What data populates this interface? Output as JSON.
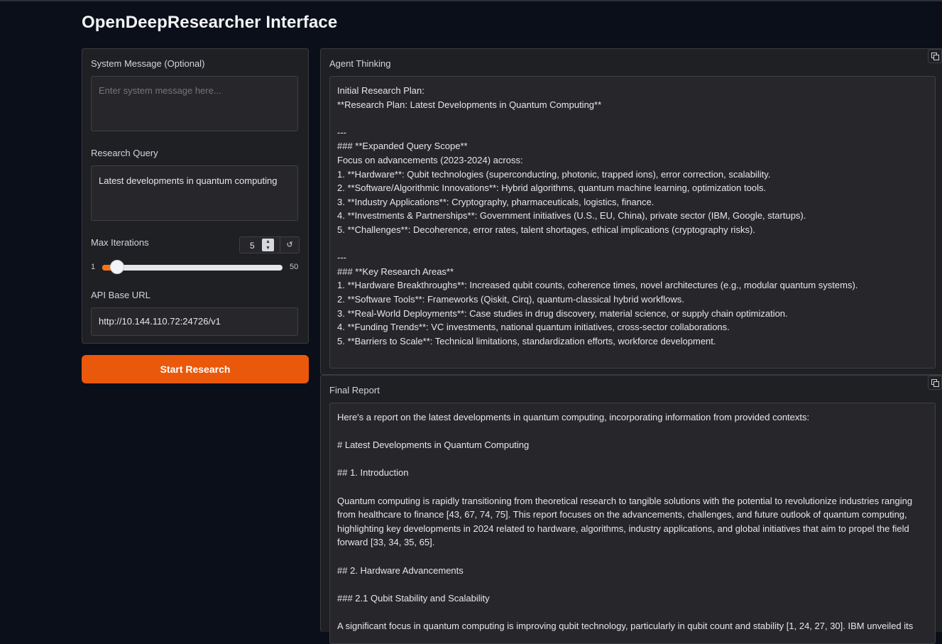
{
  "app": {
    "title": "OpenDeepResearcher Interface"
  },
  "left_panel": {
    "system_message": {
      "label": "System Message (Optional)",
      "value": "",
      "placeholder": "Enter system message here..."
    },
    "research_query": {
      "label": "Research Query",
      "value": "Latest developments in quantum computing"
    },
    "max_iterations": {
      "label": "Max Iterations",
      "value": "5",
      "min": "1",
      "max": "50",
      "reset_icon": "↺"
    },
    "api_base_url": {
      "label": "API Base URL",
      "value": "http://10.144.110.72:24726/v1"
    },
    "start_button": "Start Research"
  },
  "agent_thinking": {
    "label": "Agent Thinking",
    "lines": [
      "Initial Research Plan:",
      "**Research Plan: Latest Developments in Quantum Computing**",
      "",
      "---",
      "### **Expanded Query Scope**",
      "Focus on advancements (2023-2024) across:",
      "1. **Hardware**: Qubit technologies (superconducting, photonic, trapped ions), error correction, scalability.",
      "2. **Software/Algorithmic Innovations**: Hybrid algorithms, quantum machine learning, optimization tools.",
      "3. **Industry Applications**: Cryptography, pharmaceuticals, logistics, finance.",
      "4. **Investments & Partnerships**: Government initiatives (U.S., EU, China), private sector (IBM, Google, startups).",
      "5. **Challenges**: Decoherence, error rates, talent shortages, ethical implications (cryptography risks).",
      "",
      "---",
      "### **Key Research Areas**",
      "1. **Hardware Breakthroughs**: Increased qubit counts, coherence times, novel architectures (e.g., modular quantum systems).",
      "2. **Software Tools**: Frameworks (Qiskit, Cirq), quantum-classical hybrid workflows.",
      "3. **Real-World Deployments**: Case studies in drug discovery, material science, or supply chain optimization.",
      "4. **Funding Trends**: VC investments, national quantum initiatives, cross-sector collaborations.",
      "5. **Barriers to Scale**: Technical limitations, standardization efforts, workforce development."
    ]
  },
  "final_report": {
    "label": "Final Report",
    "paragraphs": [
      "Here's a report on the latest developments in quantum computing, incorporating information from provided contexts:",
      "# Latest Developments in Quantum Computing",
      "## 1. Introduction",
      "Quantum computing is rapidly transitioning from theoretical research to tangible solutions with the potential to revolutionize industries ranging from healthcare to finance [43, 67, 74, 75]. This report focuses on the advancements, challenges, and future outlook of quantum computing, highlighting key developments in 2024 related to hardware, algorithms, industry applications, and global initiatives that aim to propel the field forward [33, 34, 35, 65].",
      "## 2. Hardware Advancements",
      "### 2.1 Qubit Stability and Scalability",
      "A significant focus in quantum computing is improving qubit technology, particularly in qubit count and stability [1, 24, 27, 30]. IBM unveiled its"
    ]
  },
  "icons": {
    "copy": "copy-icon",
    "reset": "reset-icon"
  },
  "colors": {
    "background": "#0b0f19",
    "panel": "#1f2024",
    "accent": "#ea580c"
  }
}
